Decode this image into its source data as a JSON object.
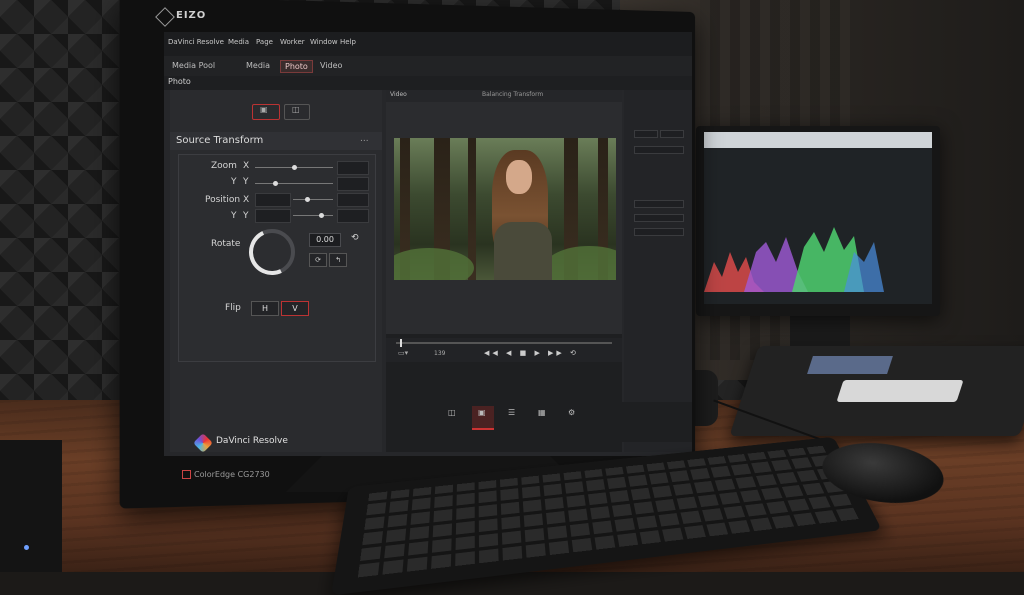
{
  "monitor_brand": "EIZO",
  "monitor_model": "ColorEdge CG2730",
  "app": {
    "name": "DaVinci Resolve",
    "menu": [
      "DaVinci Resolve",
      "Media",
      "Page",
      "Worker",
      "Window",
      "Help"
    ],
    "tabs": [
      {
        "label": "Media Pool",
        "active": false
      },
      {
        "label": "Media",
        "active": false
      },
      {
        "label": "Photo",
        "active": true
      },
      {
        "label": "Video",
        "active": false
      }
    ],
    "panel_label": "Photo",
    "footer_name": "DaVinci Resolve"
  },
  "inspector": {
    "title": "Source Transform",
    "more": "...",
    "zoom": {
      "label": "Zoom",
      "x_label": "X",
      "y_label": "Y",
      "y_axis_label": "Y",
      "x_value": 0.5,
      "y_value": 0.25
    },
    "position": {
      "label": "Position",
      "x_label": "X",
      "y_label": "Y",
      "y_axis_label": "Y",
      "x_value": 0.35,
      "y_value": 0.7
    },
    "rotate": {
      "label": "Rotate",
      "value": "0.00"
    },
    "flip": {
      "label": "Flip",
      "h": "H",
      "v": "V"
    }
  },
  "viewer": {
    "label": "Video",
    "title": "Balancing Transform",
    "timecode": "139",
    "controls": "◀◀ ◀ ■ ▶ ▶▶ ⟲",
    "playhead": 0.02
  },
  "pages": [
    {
      "name": "camera-icon",
      "glyph": "◫",
      "active": false
    },
    {
      "name": "photo-icon",
      "glyph": "▣",
      "active": true
    },
    {
      "name": "layers-icon",
      "glyph": "☰",
      "active": false
    },
    {
      "name": "grid-icon",
      "glyph": "▦",
      "active": false
    },
    {
      "name": "settings-icon",
      "glyph": "⚙",
      "active": false
    }
  ],
  "colors": {
    "accent": "#c33333",
    "panel": "#2a2b2e",
    "screen_bg": "#26272a"
  }
}
